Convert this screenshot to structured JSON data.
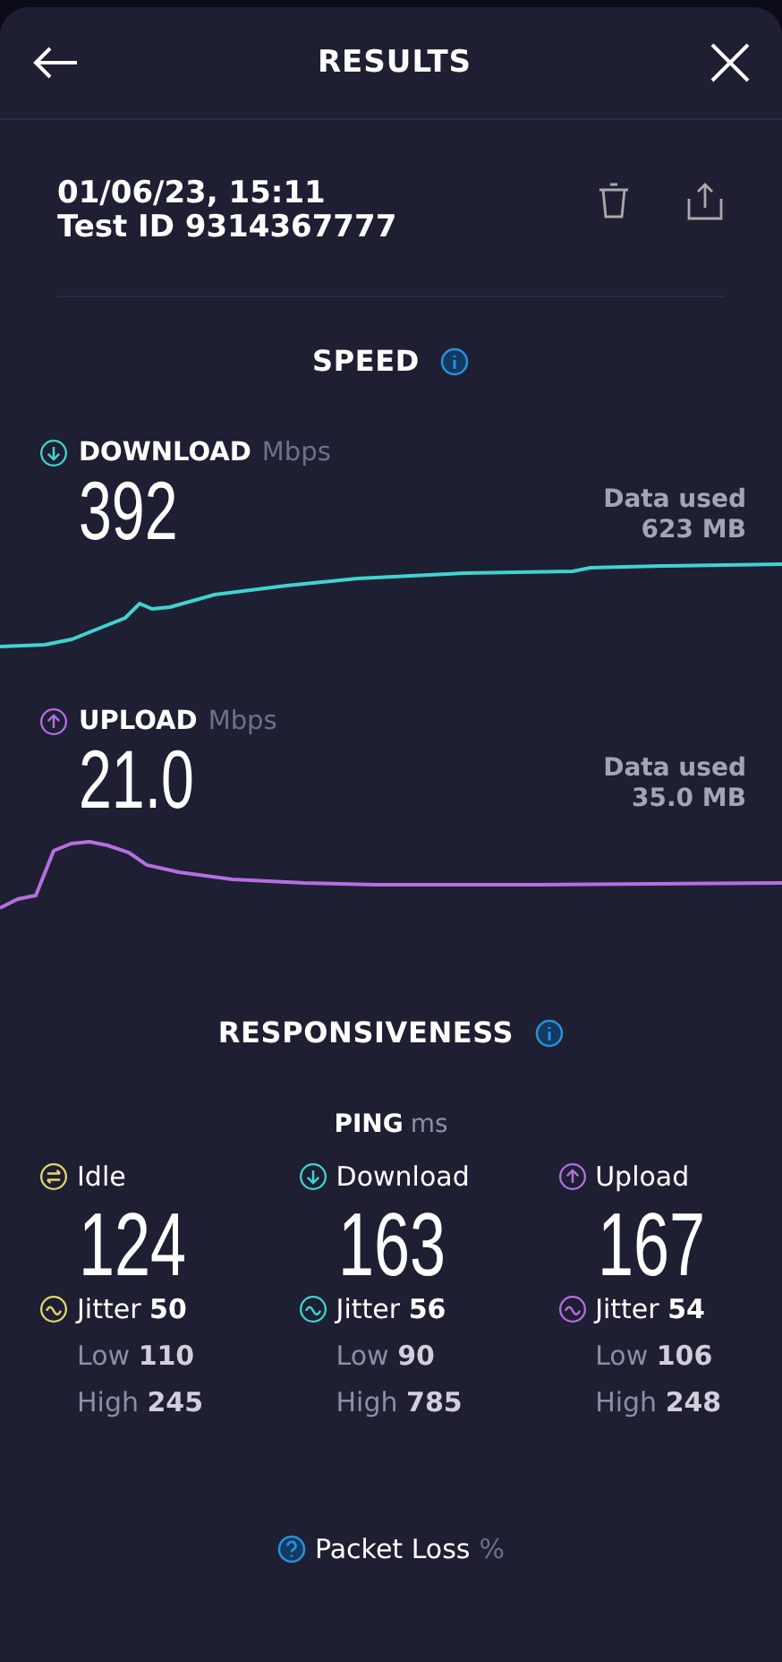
{
  "header": {
    "title": "RESULTS"
  },
  "test": {
    "date": "01/06/23, 15:11",
    "test_id": "Test ID 9314367777"
  },
  "speed": {
    "title": "SPEED",
    "metrics": [
      {
        "kind": "download",
        "label": "DOWNLOAD",
        "unit": "Mbps",
        "value": "392",
        "data_used_label": "Data used",
        "data_used": "623 MB",
        "color": "#3fd4cf"
      },
      {
        "kind": "upload",
        "label": "UPLOAD",
        "unit": "Mbps",
        "value": "21.0",
        "data_used_label": "Data used",
        "data_used": "35.0 MB",
        "color": "#b56fe0"
      }
    ]
  },
  "responsiveness": {
    "title": "RESPONSIVENESS",
    "ping_label": "PING",
    "ping_unit": "ms",
    "columns": [
      {
        "kind": "idle",
        "label": "Idle",
        "value": "124",
        "jitter": "Jitter **50**",
        "low": "Low **110**",
        "high": "High **245**",
        "color": "#e4d46c"
      },
      {
        "kind": "download",
        "label": "Download",
        "value": "163",
        "jitter": "Jitter **56**",
        "low": "Low **90**",
        "high": "High **785**",
        "color": "#3fd4cf"
      },
      {
        "kind": "upload",
        "label": "Upload",
        "value": "167",
        "jitter": "Jitter **54**",
        "low": "Low **106**",
        "high": "High **248**",
        "color": "#b56fe0"
      }
    ]
  },
  "packet_loss": {
    "label": "Packet Loss",
    "unit": "%"
  }
}
